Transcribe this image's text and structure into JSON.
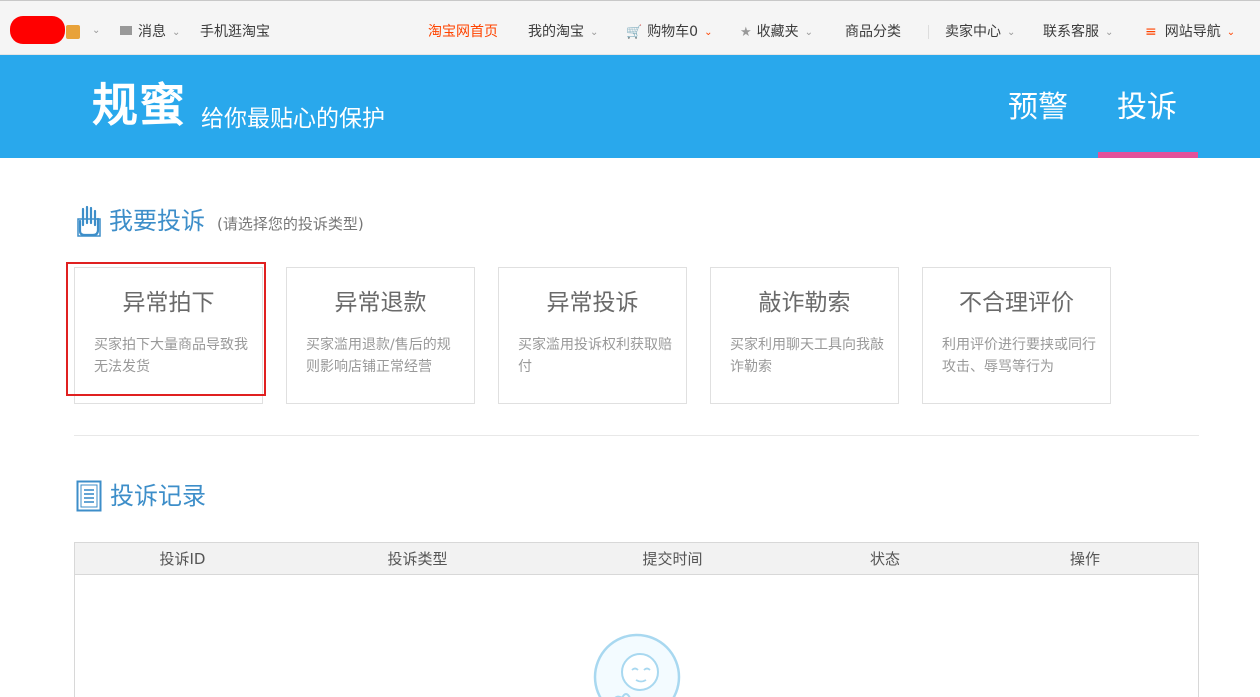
{
  "topbar": {
    "messages": "消息",
    "mobile": "手机逛淘宝",
    "taobao_home": "淘宝网首页",
    "my_taobao": "我的淘宝",
    "cart": "购物车0",
    "favorites": "收藏夹",
    "categories": "商品分类",
    "seller_center": "卖家中心",
    "customer_service": "联系客服",
    "site_nav": "网站导航"
  },
  "header": {
    "title": "规蜜",
    "subtitle": "给你最贴心的保护",
    "tabs": [
      {
        "label": "预警"
      },
      {
        "label": "投诉"
      }
    ],
    "active_tab": "投诉",
    "color": "#29a8ec",
    "underline_color": "#e4519a"
  },
  "complaint": {
    "title": "我要投诉",
    "hint": "(请选择您的投诉类型)",
    "cards": [
      {
        "title": "异常拍下",
        "desc": "买家拍下大量商品导致我无法发货"
      },
      {
        "title": "异常退款",
        "desc": "买家滥用退款/售后的规则影响店铺正常经营"
      },
      {
        "title": "异常投诉",
        "desc": "买家滥用投诉权利获取赔付"
      },
      {
        "title": "敲诈勒索",
        "desc": "买家利用聊天工具向我敲诈勒索"
      },
      {
        "title": "不合理评价",
        "desc": "利用评价进行要挟或同行攻击、辱骂等行为"
      }
    ],
    "selected_card": "异常拍下"
  },
  "records": {
    "title": "投诉记录",
    "columns": [
      "投诉ID",
      "投诉类型",
      "提交时间",
      "状态",
      "操作"
    ]
  },
  "icons": {
    "hand": "hand-icon",
    "document": "document-icon",
    "mail": "mail-icon",
    "cart": "cart-icon",
    "star": "star-icon",
    "menu": "menu-icon"
  }
}
